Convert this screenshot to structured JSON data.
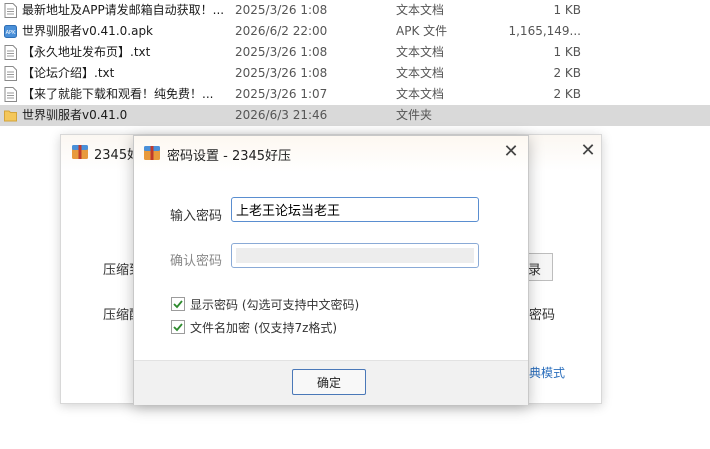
{
  "files": [
    {
      "name": "最新地址及APP请发邮箱自动获取！...",
      "date": "2025/3/26 1:08",
      "type": "文本文档",
      "size": "1 KB",
      "icon": "text-file-icon"
    },
    {
      "name": "世界驯服者v0.41.0.apk",
      "date": "2026/6/2 22:00",
      "type": "APK 文件",
      "size": "1,165,149...",
      "icon": "apk-file-icon"
    },
    {
      "name": "【永久地址发布页】.txt",
      "date": "2025/3/26 1:08",
      "type": "文本文档",
      "size": "1 KB",
      "icon": "text-file-icon"
    },
    {
      "name": "【论坛介绍】.txt",
      "date": "2025/3/26 1:08",
      "type": "文本文档",
      "size": "2 KB",
      "icon": "text-file-icon"
    },
    {
      "name": "【来了就能下载和观看！纯免费！...",
      "date": "2025/3/26 1:07",
      "type": "文本文档",
      "size": "2 KB",
      "icon": "text-file-icon"
    },
    {
      "name": "世界驯服者v0.41.0",
      "date": "2026/6/3 21:46",
      "type": "文件夹",
      "size": "",
      "icon": "folder-icon"
    }
  ],
  "back_window": {
    "title": "2345好",
    "label1": "压缩到",
    "label2": "压缩配",
    "button_fragment": "录",
    "label_fragment": "密码",
    "classic_mode": "经典模式"
  },
  "dialog": {
    "title": "密码设置 - 2345好压",
    "password_label": "输入密码",
    "password_value": "上老王论坛当老王",
    "confirm_label": "确认密码",
    "show_password_label": "显示密码 (勾选可支持中文密码)",
    "encrypt_filename_label": "文件名加密 (仅支持7z格式)",
    "ok_label": "确定"
  },
  "colors": {
    "selected_row": "#d9d9d9",
    "input_border": "#5a8ed0",
    "link_blue": "#2c6fbd",
    "check_green": "#2e8b2e"
  }
}
